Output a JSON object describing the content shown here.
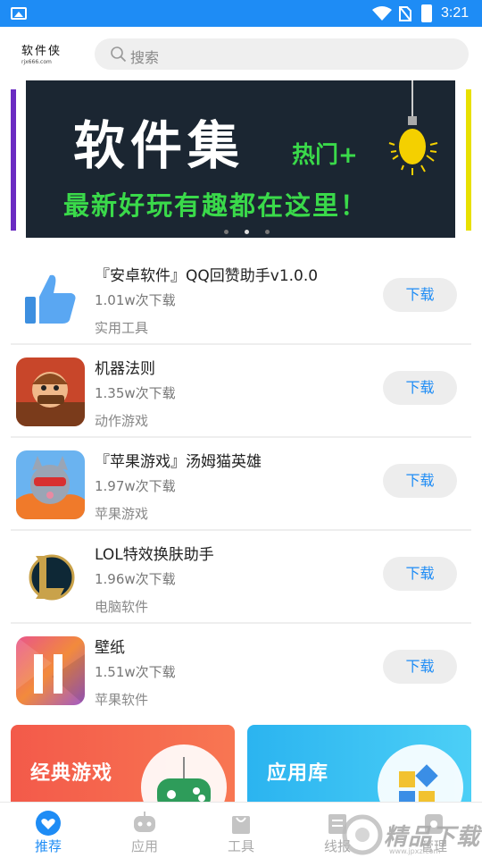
{
  "status_bar": {
    "time": "3:21"
  },
  "header": {
    "logo_text": "软件侠",
    "logo_sub": "rjx666.com",
    "search_placeholder": "搜索"
  },
  "banner": {
    "title": "软件集",
    "hot": "热门+",
    "subtitle": "最新好玩有趣都在这里！",
    "slide_count": 3,
    "active_slide": 2
  },
  "apps": [
    {
      "name": "『安卓软件』QQ回赞助手v1.0.0",
      "downloads": "1.01w次下载",
      "category": "实用工具",
      "button": "下载",
      "icon": "thumbs-up-icon"
    },
    {
      "name": "机器法则",
      "downloads": "1.35w次下载",
      "category": "动作游戏",
      "button": "下载",
      "icon": "game-character-icon"
    },
    {
      "name": "『苹果游戏』汤姆猫英雄",
      "downloads": "1.97w次下载",
      "category": "苹果游戏",
      "button": "下载",
      "icon": "tom-cat-icon"
    },
    {
      "name": "LOL特效换肤助手",
      "downloads": "1.96w次下载",
      "category": "电脑软件",
      "button": "下载",
      "icon": "lol-logo-icon"
    },
    {
      "name": "壁纸",
      "downloads": "1.51w次下载",
      "category": "苹果软件",
      "button": "下载",
      "icon": "wallpaper-11-icon"
    }
  ],
  "cards": [
    {
      "title": "经典游戏",
      "icon": "gamepad-icon",
      "color": "#f35a4a"
    },
    {
      "title": "应用库",
      "icon": "app-blocks-icon",
      "color": "#2bb4f0"
    }
  ],
  "nav": [
    {
      "label": "推荐",
      "icon": "heart-icon",
      "active": true
    },
    {
      "label": "应用",
      "icon": "robot-icon",
      "active": false
    },
    {
      "label": "工具",
      "icon": "bag-icon",
      "active": false
    },
    {
      "label": "线报",
      "icon": "news-icon",
      "active": false
    },
    {
      "label": "管理",
      "icon": "manage-icon",
      "active": false
    }
  ],
  "watermark": {
    "text": "精品下载",
    "sub": "www.jpxz.com"
  },
  "colors": {
    "primary": "#1e8cf5",
    "banner_bg": "#1b2632",
    "banner_green": "#3ad94a"
  }
}
